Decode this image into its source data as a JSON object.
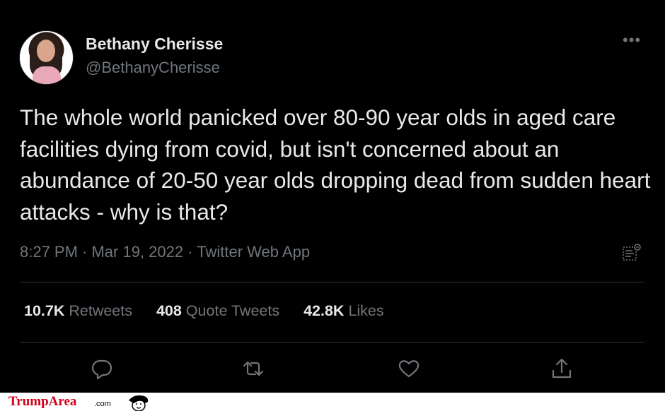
{
  "user": {
    "display_name": "Bethany Cherisse",
    "handle": "@BethanyCherisse",
    "avatar_icon": "profile-photo"
  },
  "tweet": {
    "text": "The whole world panicked over 80-90 year olds in aged care facilities dying from covid, but isn't concerned about an abundance of 20-50 year olds dropping dead from sudden heart attacks - why is that?",
    "meta": "8:27 PM · Mar 19, 2022 · Twitter Web App"
  },
  "stats": {
    "retweets_count": "10.7K",
    "retweets_label": "Retweets",
    "quotes_count": "408",
    "quotes_label": "Quote Tweets",
    "likes_count": "42.8K",
    "likes_label": "Likes"
  },
  "actions": [
    "reply-icon",
    "retweet-icon",
    "like-icon",
    "share-icon"
  ],
  "footer": {
    "brand": "TrumpArea",
    "brand_suffix": ".com"
  },
  "colors": {
    "background": "#000000",
    "text": "#e7e9ea",
    "secondary": "#71767b",
    "divider": "#2f3336",
    "brand": "#d0021b"
  }
}
